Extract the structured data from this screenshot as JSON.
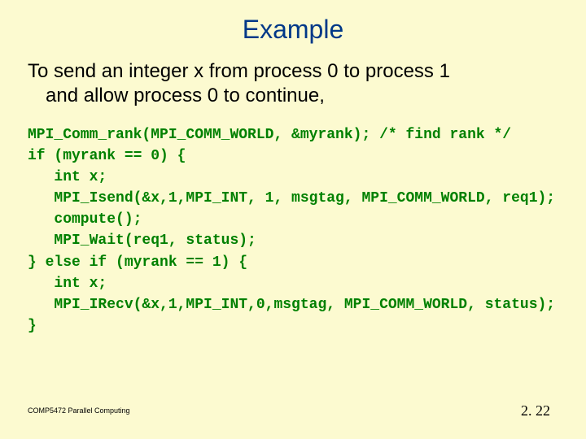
{
  "title": "Example",
  "description_line1": "To send an integer x from process 0 to process 1",
  "description_line2": "and allow process 0 to continue,",
  "code": "MPI_Comm_rank(MPI_COMM_WORLD, &myrank); /* find rank */\nif (myrank == 0) {\n   int x;\n   MPI_Isend(&x,1,MPI_INT, 1, msgtag, MPI_COMM_WORLD, req1);\n   compute();\n   MPI_Wait(req1, status);\n} else if (myrank == 1) {\n   int x;\n   MPI_IRecv(&x,1,MPI_INT,0,msgtag, MPI_COMM_WORLD, status);\n}",
  "footer_left": "COMP5472 Parallel Computing",
  "footer_right": "2. 22"
}
